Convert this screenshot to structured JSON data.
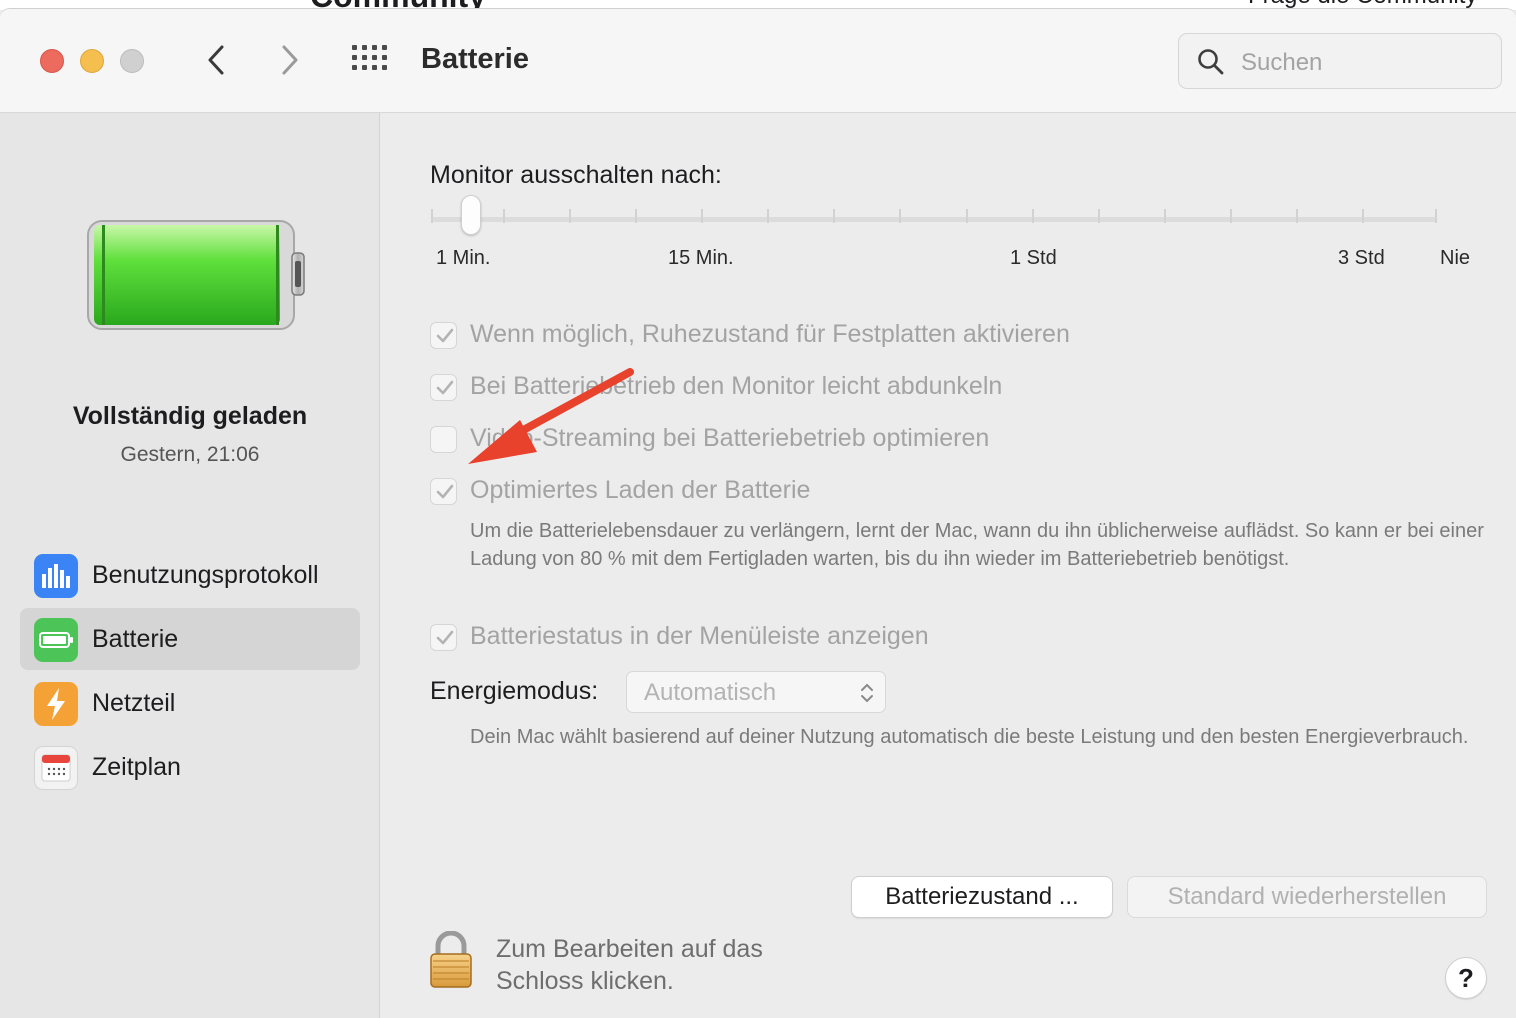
{
  "background_strip": {
    "left_text": "Community",
    "right_text": "Frage die Community"
  },
  "window": {
    "title": "Batterie"
  },
  "search": {
    "placeholder": "Suchen"
  },
  "sidebar": {
    "status_title": "Vollständig geladen",
    "status_time": "Gestern, 21:06",
    "items": [
      {
        "label": "Benutzungsprotokoll",
        "icon": "bar-chart-icon",
        "color": "#3a84f5"
      },
      {
        "label": "Batterie",
        "icon": "battery-icon",
        "color": "#4cc457",
        "selected": true
      },
      {
        "label": "Netzteil",
        "icon": "lightning-icon",
        "color": "#f4a235"
      },
      {
        "label": "Zeitplan",
        "icon": "calendar-icon",
        "color": "#f0f0f0"
      }
    ]
  },
  "monitor": {
    "label": "Monitor ausschalten nach:",
    "tick_labels": [
      "1 Min.",
      "15 Min.",
      "1 Std",
      "3 Std",
      "Nie"
    ],
    "value": "1 Min."
  },
  "options": [
    {
      "label": "Wenn möglich, Ruhezustand für Festplatten aktivieren",
      "checked": true
    },
    {
      "label": "Bei Batteriebetrieb den Monitor leicht abdunkeln",
      "checked": true
    },
    {
      "label": "Video-Streaming bei Batteriebetrieb optimieren",
      "checked": false
    },
    {
      "label": "Optimiertes Laden der Batterie",
      "checked": true
    },
    {
      "label": "Batteriestatus in der Menüleiste anzeigen",
      "checked": true
    }
  ],
  "optimized_charging_desc": "Um die Batterielebensdauer zu verlängern, lernt der Mac, wann du ihn üblicherweise auflädst. So kann er bei einer Ladung von 80 % mit dem Fertigladen warten, bis du ihn wieder im Batteriebetrieb benötigst.",
  "energy": {
    "label": "Energiemodus:",
    "value": "Automatisch",
    "description": "Dein Mac wählt basierend auf deiner Nutzung automatisch die beste Leistung und den besten Energieverbrauch."
  },
  "buttons": {
    "battery_health": "Batteriezustand ...",
    "restore_defaults": "Standard wiederherstellen"
  },
  "lock": {
    "text": "Zum Bearbeiten auf das Schloss klicken."
  },
  "help": {
    "label": "?"
  },
  "annotation": {
    "arrow_color": "#e8412c"
  }
}
